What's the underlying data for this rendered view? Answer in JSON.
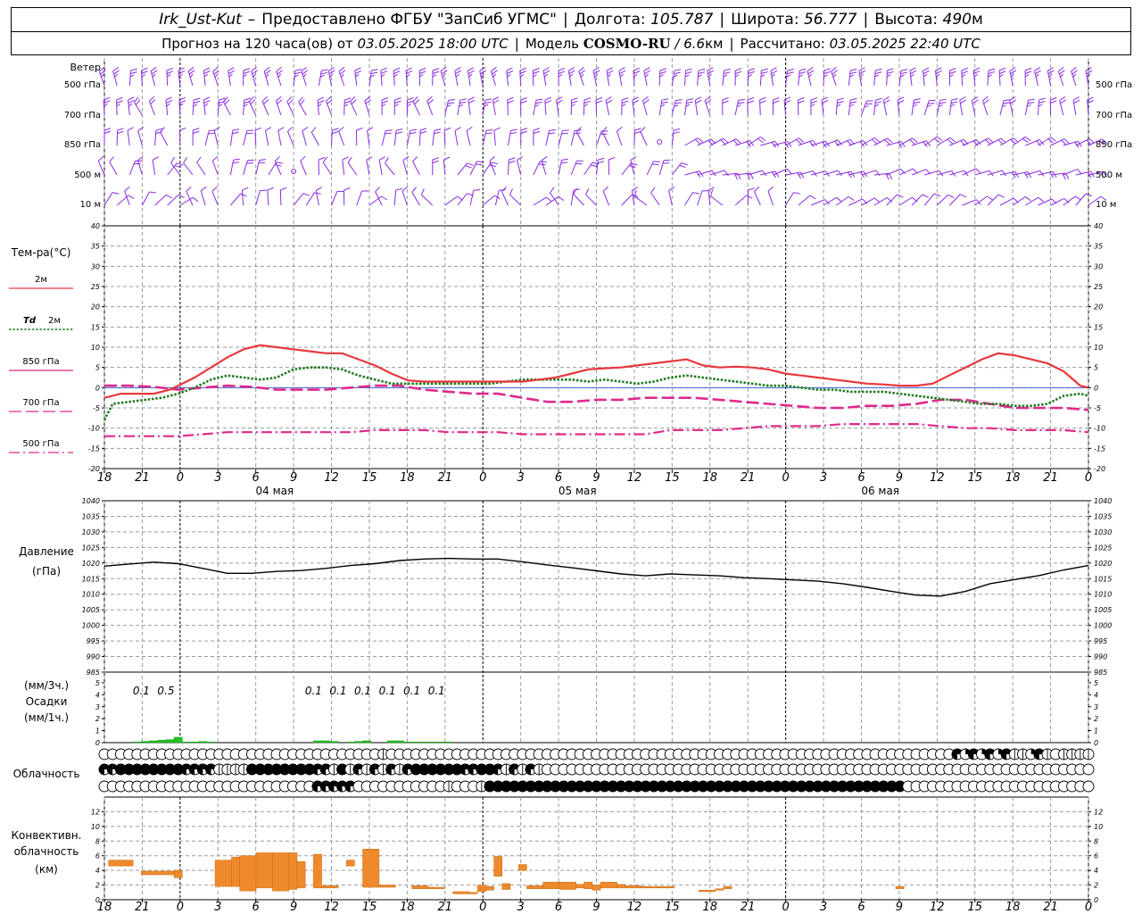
{
  "header": {
    "station": "Irk_Ust-Kut",
    "dash": "–",
    "provider": "Предоставлено ФГБУ \"ЗапСиб УГМС\"",
    "lon_label": "Долгота:",
    "lon_value": "105.787",
    "lat_label": "Широта:",
    "lat_value": "56.777",
    "alt_label": "Высота:",
    "alt_value": "490",
    "alt_unit": "м",
    "forecast_label": "Прогноз на 120 часа(ов)  от",
    "forecast_start": "03.05.2025 18:00 UTC",
    "model_label": "Модель",
    "model_name": "COSMO-RU",
    "model_res": "/ 6.6",
    "model_res_unit": "км",
    "calc_label": "Рассчитано:",
    "calc_time": "03.05.2025 22:40 UTC"
  },
  "time_axis": {
    "hour_labels": [
      "18",
      "21",
      "0",
      "3",
      "6",
      "9",
      "12",
      "15",
      "18",
      "21",
      "0",
      "3",
      "6",
      "9",
      "12",
      "15",
      "18",
      "21",
      "0",
      "3",
      "6",
      "9",
      "12",
      "15",
      "18",
      "21",
      "0"
    ],
    "day_labels": [
      "04 мая",
      "05 мая",
      "06 мая"
    ]
  },
  "wind": {
    "title": "Ветер",
    "levels": [
      "500 гПа",
      "700 гПа",
      "850 гПа",
      "500 м",
      "10 м"
    ],
    "color": "#8a2be2"
  },
  "temperature": {
    "title": "Тем-ра(°C)",
    "legend": [
      {
        "label": "2м",
        "color": "#e8383d",
        "style": "solid"
      },
      {
        "label_italic": "Td",
        "label": "2м",
        "color": "#1f7a1f",
        "style": "dotted"
      },
      {
        "label": "850 гПа",
        "color": "#e0288c",
        "style": "solid-thin"
      },
      {
        "label": "700 гПа",
        "color": "#e0288c",
        "style": "dashed"
      },
      {
        "label": "500 гПа",
        "color": "#e0288c",
        "style": "dashdot"
      }
    ],
    "y_ticks": [
      "40",
      "35",
      "30",
      "25",
      "20",
      "15",
      "10",
      "5",
      "0",
      "-5",
      "-10",
      "-15",
      "-20"
    ]
  },
  "pressure": {
    "title": "Давление",
    "unit": "(гПа)",
    "y_ticks": [
      "1040",
      "1035",
      "1030",
      "1025",
      "1020",
      "1015",
      "1010",
      "1005",
      "1000",
      "995",
      "990",
      "985"
    ]
  },
  "precip": {
    "title_line1": "(мм/3ч.)",
    "title_line2": "Осадки",
    "title_line3": "(мм/1ч.)",
    "y_ticks": [
      "5",
      "4",
      "3",
      "2",
      "1",
      "0"
    ],
    "labels": [
      {
        "hour": 4.5,
        "text": "0.1"
      },
      {
        "hour": 7.5,
        "text": "0.5"
      },
      {
        "hour": 25.5,
        "text": "0.1"
      },
      {
        "hour": 28.5,
        "text": "0.1"
      },
      {
        "hour": 31.5,
        "text": "0.1"
      },
      {
        "hour": 34.5,
        "text": "0.1"
      },
      {
        "hour": 37.5,
        "text": "0.1"
      },
      {
        "hour": 40.5,
        "text": "0.1"
      }
    ]
  },
  "cloud": {
    "title": "Облачность"
  },
  "convective": {
    "title_line1": "Конвективн.",
    "title_line2": "облачность",
    "title_line3": "(км)",
    "y_ticks": [
      "12",
      "10",
      "8",
      "6",
      "4",
      "2",
      "0"
    ],
    "bar_color": "#ef8a2c"
  },
  "chart_data": [
    {
      "type": "line",
      "title": "Тем-ра(°C)",
      "x_unit": "hours from 03.05.2025 18:00 UTC",
      "ylim": [
        -20,
        40
      ],
      "series": [
        {
          "name": "2м",
          "x": [
            0,
            2,
            4,
            6,
            8,
            9,
            11,
            13,
            15,
            17,
            19,
            21,
            23,
            25,
            27,
            29,
            31,
            33,
            35,
            37,
            39,
            41,
            43,
            45,
            47,
            49,
            51,
            53,
            55,
            57,
            59,
            61,
            63,
            65,
            67,
            69,
            71,
            73,
            75,
            77,
            79,
            81,
            83,
            85,
            87,
            89,
            91,
            93,
            95,
            97,
            99,
            101,
            103,
            105,
            107,
            109,
            111,
            113,
            115,
            117,
            119,
            120
          ],
          "y": [
            -2.5,
            -1.5,
            -1.5,
            -1.5,
            -0.5,
            0.5,
            2.5,
            5.0,
            7.5,
            9.5,
            10.5,
            10.0,
            9.5,
            9.0,
            8.5,
            8.5,
            7.0,
            5.5,
            3.5,
            1.8,
            1.5,
            1.5,
            1.5,
            1.5,
            1.5,
            1.5,
            1.5,
            2.0,
            2.5,
            3.5,
            4.5,
            4.8,
            5.0,
            5.5,
            6.0,
            6.5,
            7.0,
            5.5,
            5.0,
            5.2,
            5.0,
            4.5,
            3.5,
            3.0,
            2.5,
            2.0,
            1.5,
            1.0,
            0.8,
            0.5,
            0.5,
            1.0,
            3.0,
            5.0,
            7.0,
            8.5,
            8.0,
            7.0,
            6.0,
            4.0,
            0.5,
            0
          ]
        },
        {
          "name": "Td 2м",
          "x": [
            0,
            1,
            3,
            5,
            7,
            9,
            11,
            13,
            15,
            17,
            19,
            21,
            23,
            25,
            27,
            29,
            31,
            33,
            35,
            37,
            39,
            41,
            43,
            45,
            47,
            49,
            51,
            53,
            55,
            57,
            59,
            61,
            63,
            65,
            67,
            69,
            71,
            73,
            75,
            77,
            79,
            81,
            83,
            85,
            87,
            89,
            91,
            93,
            95,
            97,
            99,
            101,
            103,
            105,
            107,
            109,
            111,
            113,
            115,
            117,
            119,
            120
          ],
          "y": [
            -8.0,
            -4.0,
            -3.5,
            -3.0,
            -2.5,
            -1.5,
            0.0,
            2.0,
            3.0,
            2.5,
            2.0,
            2.5,
            4.5,
            5.0,
            5.0,
            4.5,
            3.0,
            2.0,
            1.0,
            1.0,
            1.0,
            1.0,
            1.0,
            1.0,
            1.0,
            1.5,
            2.0,
            2.0,
            2.0,
            2.0,
            1.5,
            2.0,
            1.5,
            1.0,
            1.5,
            2.5,
            3.0,
            2.5,
            2.0,
            1.5,
            1.0,
            0.5,
            0.5,
            0.0,
            -0.5,
            -0.5,
            -1.0,
            -1.0,
            -1.0,
            -1.5,
            -2.0,
            -2.5,
            -3.0,
            -3.5,
            -4.0,
            -4.0,
            -4.5,
            -4.5,
            -4.0,
            -2.0,
            -1.5,
            -2.0
          ]
        },
        {
          "name": "850 гПа",
          "x": [
            0,
            4,
            8,
            12,
            16,
            20,
            24,
            28,
            32,
            36,
            40,
            44,
            48,
            52,
            56,
            60,
            64,
            68,
            72,
            76,
            80,
            84,
            88,
            92,
            96,
            100,
            104,
            108,
            112,
            116,
            120
          ],
          "y": [
            -0.5,
            -0.3,
            0.0,
            -0.2,
            0.0,
            0.0,
            0.0,
            -0.3,
            -0.5,
            0.0,
            0.0,
            -0.5,
            -1.0,
            -1.5,
            -2.0,
            -2.5,
            -2.5,
            -2.5,
            -2.5,
            -3.0,
            -3.5,
            -4.0,
            -4.5,
            -5.0,
            -5.0,
            -4.5,
            -4.0,
            -4.0,
            -4.5,
            -4.5,
            -5.0
          ]
        },
        {
          "name": "700 гПа",
          "x": [
            0,
            3,
            6,
            9,
            12,
            15,
            18,
            21,
            24,
            27,
            30,
            33,
            36,
            39,
            42,
            45,
            48,
            51,
            54,
            57,
            60,
            63,
            66,
            69,
            72,
            75,
            78,
            81,
            84,
            87,
            90,
            93,
            96,
            99,
            102,
            105,
            108,
            111,
            114,
            117,
            120
          ],
          "y": [
            0.5,
            0.5,
            0.2,
            -0.5,
            0.0,
            0.5,
            0.2,
            -0.5,
            -0.5,
            -0.5,
            0.0,
            0.5,
            0.5,
            -0.5,
            -1.0,
            -1.5,
            -1.5,
            -2.5,
            -3.5,
            -3.5,
            -3.0,
            -3.0,
            -2.5,
            -2.5,
            -2.5,
            -3.0,
            -3.5,
            -4.0,
            -4.5,
            -5.0,
            -5.0,
            -4.5,
            -4.5,
            -4.0,
            -3.0,
            -3.0,
            -4.0,
            -5.0,
            -5.0,
            -5.0,
            -5.5
          ]
        },
        {
          "name": "500 гПа",
          "x": [
            0,
            3,
            6,
            9,
            12,
            15,
            18,
            21,
            24,
            27,
            30,
            33,
            36,
            39,
            42,
            45,
            48,
            51,
            54,
            57,
            60,
            63,
            66,
            69,
            72,
            75,
            78,
            81,
            84,
            87,
            90,
            93,
            96,
            99,
            102,
            105,
            108,
            111,
            114,
            117,
            120
          ],
          "y": [
            -12.0,
            -12.0,
            -12.0,
            -12.0,
            -11.5,
            -11.0,
            -11.0,
            -11.0,
            -11.0,
            -11.0,
            -11.0,
            -10.5,
            -10.5,
            -10.5,
            -11.0,
            -11.0,
            -11.0,
            -11.5,
            -11.5,
            -11.5,
            -11.5,
            -11.5,
            -11.5,
            -10.5,
            -10.5,
            -10.5,
            -10.0,
            -9.5,
            -9.5,
            -9.5,
            -9.0,
            -9.0,
            -9.0,
            -9.0,
            -9.5,
            -10.0,
            -10.0,
            -10.5,
            -10.5,
            -10.5,
            -11.0
          ]
        }
      ]
    },
    {
      "type": "line",
      "title": "Давление",
      "x_unit": "hours from 03.05.2025 18:00 UTC",
      "ylim": [
        985,
        1040
      ],
      "series": [
        {
          "name": "Давление",
          "x": [
            0,
            3,
            6,
            9,
            12,
            15,
            18,
            21,
            24,
            27,
            30,
            33,
            36,
            39,
            42,
            45,
            48,
            51,
            54,
            57,
            60,
            63,
            66,
            69,
            72,
            75,
            78,
            81,
            84,
            87,
            90,
            93,
            96,
            99,
            102,
            105,
            108,
            111,
            114,
            117,
            120
          ],
          "y": [
            1019,
            1019.7,
            1020.3,
            1019.8,
            1018.3,
            1016.7,
            1016.7,
            1017.3,
            1017.6,
            1018.3,
            1019.2,
            1019.8,
            1020.8,
            1021.3,
            1021.5,
            1021.3,
            1021.3,
            1020.4,
            1019.4,
            1018.5,
            1017.5,
            1016.5,
            1015.9,
            1016.5,
            1016.2,
            1015.9,
            1015.3,
            1015.0,
            1014.6,
            1014.2,
            1013.4,
            1012.2,
            1010.9,
            1009.7,
            1009.4,
            1010.9,
            1013.4,
            1014.7,
            1016.0,
            1017.8,
            1019.2
          ]
        }
      ]
    },
    {
      "type": "bar",
      "title": "Осадки",
      "x_unit": "hours from 03.05.2025 18:00 UTC",
      "ylim": [
        0,
        5
      ],
      "series": [
        {
          "name": "мм/1ч.",
          "x": [
            4,
            5,
            6,
            7,
            8,
            9,
            10,
            11,
            12,
            13,
            26,
            27,
            28,
            30,
            31,
            32,
            35,
            36,
            37,
            38,
            39,
            40,
            41,
            42
          ],
          "y": [
            0.05,
            0.1,
            0.15,
            0.2,
            0.25,
            0.45,
            0.05,
            0.05,
            0.1,
            0.05,
            0.15,
            0.15,
            0.1,
            0.05,
            0.1,
            0.15,
            0.15,
            0.15,
            0.05,
            0.05,
            0.05,
            0.05,
            0.05,
            0.05
          ]
        }
      ]
    },
    {
      "type": "bar",
      "title": "Конвективн. облачность (км)",
      "x_unit": "hours from 03.05.2025 18:00 UTC",
      "ylim": [
        0,
        14
      ],
      "bars": [
        {
          "x0": 0.5,
          "x1": 3.5,
          "bottom": 4.6,
          "top": 5.4
        },
        {
          "x0": 4.5,
          "x1": 8.5,
          "bottom": 3.4,
          "top": 3.9
        },
        {
          "x0": 8.5,
          "x1": 9.5,
          "bottom": 3.0,
          "top": 4.0
        },
        {
          "x0": 13.5,
          "x1": 15.5,
          "bottom": 1.8,
          "top": 5.4
        },
        {
          "x0": 15.5,
          "x1": 16.5,
          "bottom": 1.8,
          "top": 5.8
        },
        {
          "x0": 16.5,
          "x1": 18.5,
          "bottom": 1.2,
          "top": 6.0
        },
        {
          "x0": 18.5,
          "x1": 20.5,
          "bottom": 1.6,
          "top": 6.4
        },
        {
          "x0": 20.5,
          "x1": 22.5,
          "bottom": 1.2,
          "top": 6.4
        },
        {
          "x0": 22.5,
          "x1": 23.5,
          "bottom": 1.4,
          "top": 6.4
        },
        {
          "x0": 23.5,
          "x1": 24.5,
          "bottom": 1.6,
          "top": 5.2
        },
        {
          "x0": 25.5,
          "x1": 26.5,
          "bottom": 1.6,
          "top": 6.2
        },
        {
          "x0": 26.5,
          "x1": 28.5,
          "bottom": 1.6,
          "top": 1.9
        },
        {
          "x0": 29.5,
          "x1": 30.5,
          "bottom": 4.6,
          "top": 5.4
        },
        {
          "x0": 31.5,
          "x1": 33.5,
          "bottom": 1.7,
          "top": 6.9
        },
        {
          "x0": 33.5,
          "x1": 35.5,
          "bottom": 1.7,
          "top": 2.0
        },
        {
          "x0": 37.5,
          "x1": 39.5,
          "bottom": 1.5,
          "top": 1.9
        },
        {
          "x0": 39.5,
          "x1": 41.5,
          "bottom": 1.5,
          "top": 1.7
        },
        {
          "x0": 42.5,
          "x1": 44.5,
          "bottom": 0.8,
          "top": 1.1
        },
        {
          "x0": 44.5,
          "x1": 45.5,
          "bottom": 0.8,
          "top": 1.0
        },
        {
          "x0": 45.5,
          "x1": 46.5,
          "bottom": 1.1,
          "top": 2.0
        },
        {
          "x0": 46.5,
          "x1": 47.5,
          "bottom": 1.3,
          "top": 1.8
        },
        {
          "x0": 47.5,
          "x1": 48.5,
          "bottom": 3.2,
          "top": 5.9
        },
        {
          "x0": 48.5,
          "x1": 49.5,
          "bottom": 1.4,
          "top": 2.2
        },
        {
          "x0": 50.5,
          "x1": 51.5,
          "bottom": 4.0,
          "top": 4.8
        },
        {
          "x0": 51.5,
          "x1": 53.5,
          "bottom": 1.5,
          "top": 1.9
        },
        {
          "x0": 53.5,
          "x1": 55.5,
          "bottom": 1.5,
          "top": 2.4
        },
        {
          "x0": 55.5,
          "x1": 57.5,
          "bottom": 1.4,
          "top": 2.4
        },
        {
          "x0": 57.5,
          "x1": 58.5,
          "bottom": 1.6,
          "top": 2.1
        },
        {
          "x0": 58.5,
          "x1": 59.5,
          "bottom": 1.5,
          "top": 2.4
        },
        {
          "x0": 59.5,
          "x1": 60.5,
          "bottom": 1.3,
          "top": 2.0
        },
        {
          "x0": 60.5,
          "x1": 62.5,
          "bottom": 1.6,
          "top": 2.4
        },
        {
          "x0": 62.5,
          "x1": 63.5,
          "bottom": 1.6,
          "top": 2.1
        },
        {
          "x0": 63.5,
          "x1": 65.5,
          "bottom": 1.6,
          "top": 1.9
        },
        {
          "x0": 65.5,
          "x1": 67.5,
          "bottom": 1.6,
          "top": 1.8
        },
        {
          "x0": 67.5,
          "x1": 69.5,
          "bottom": 1.6,
          "top": 1.8
        },
        {
          "x0": 72.5,
          "x1": 74.5,
          "bottom": 1.1,
          "top": 1.3
        },
        {
          "x0": 74.5,
          "x1": 75.5,
          "bottom": 1.3,
          "top": 1.5
        },
        {
          "x0": 75.5,
          "x1": 76.5,
          "bottom": 1.5,
          "top": 1.8
        },
        {
          "x0": 96.5,
          "x1": 97.5,
          "bottom": 1.5,
          "top": 1.8
        }
      ]
    }
  ]
}
